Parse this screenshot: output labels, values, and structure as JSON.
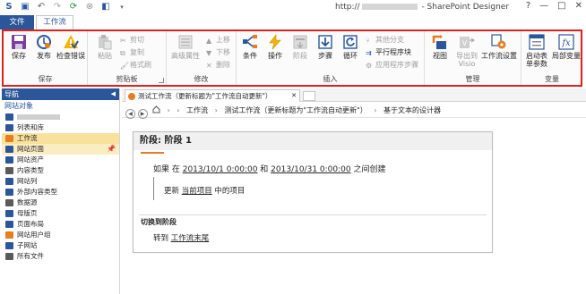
{
  "app": {
    "title_prefix": "http://",
    "title_suffix": " - SharePoint Designer",
    "quick_access": [
      "save-icon",
      "undo-icon",
      "redo-icon",
      "refresh-icon",
      "stop-icon",
      "preview-icon",
      "more-icon"
    ],
    "window_buttons": [
      "?",
      "—",
      "□",
      "✕"
    ]
  },
  "tabs": {
    "file": "文件",
    "workflow": "工作流"
  },
  "ribbon": {
    "save_group": {
      "label": "保存",
      "save": "保存",
      "publish": "发布",
      "check": "检查错误"
    },
    "clipboard_group": {
      "label": "剪贴板",
      "paste": "粘贴",
      "cut": "剪切",
      "copy": "复制",
      "format_painter": "格式刷"
    },
    "modify_group": {
      "label": "修改",
      "advanced_properties": "高级属性",
      "move_up": "上移",
      "move_down": "下移",
      "delete": "删除"
    },
    "insert_group": {
      "label": "插入",
      "condition": "条件",
      "action": "操作",
      "stage": "阶段",
      "step": "步骤",
      "loop": "循环",
      "other_branch": "其他分支",
      "parallel_block": "平行程序块",
      "app_step": "应用程序步骤"
    },
    "manage_group": {
      "label": "管理",
      "views": "视图",
      "export_visio_line1": "导出到",
      "export_visio_line2": "Visio",
      "workflow_settings": "工作流设置"
    },
    "variables_group": {
      "label": "变量",
      "initiation_line1": "启动表",
      "initiation_line2": "单参数",
      "local_vars": "局部变量"
    }
  },
  "nav": {
    "header": "导航",
    "section": "网站对象",
    "items": [
      {
        "label": "",
        "icon": "site-icon",
        "redacted": true
      },
      {
        "label": "列表和库",
        "icon": "list-icon"
      },
      {
        "label": "工作流",
        "icon": "workflow-icon",
        "state": "selected"
      },
      {
        "label": "网站页面",
        "icon": "pages-icon",
        "state": "current",
        "pinned": true
      },
      {
        "label": "网站资产",
        "icon": "assets-icon"
      },
      {
        "label": "内容类型",
        "icon": "content-type-icon"
      },
      {
        "label": "网站列",
        "icon": "column-icon"
      },
      {
        "label": "外部内容类型",
        "icon": "external-icon"
      },
      {
        "label": "数据源",
        "icon": "datasource-icon"
      },
      {
        "label": "母版页",
        "icon": "master-page-icon"
      },
      {
        "label": "页面布局",
        "icon": "layout-icon"
      },
      {
        "label": "网站用户组",
        "icon": "group-icon"
      },
      {
        "label": "子网站",
        "icon": "subsite-icon"
      },
      {
        "label": "所有文件",
        "icon": "files-icon"
      }
    ]
  },
  "document": {
    "tab_title": "测试工作流（更新标题为\"工作流自动更新\"）",
    "breadcrumb": [
      "工作流",
      "测试工作流（更新标题为\"工作流自动更新\"）",
      "基于文本的设计器"
    ],
    "stage": {
      "title": "阶段: 阶段 1",
      "cond_prefix": "如果 在 ",
      "cond_date1": "2013/10/1 0:00:00",
      "cond_mid": " 和 ",
      "cond_date2": "2013/10/31 0:00:00",
      "cond_suffix": " 之间创建",
      "action_prefix": "更新 ",
      "action_link": "当前项目",
      "action_suffix": " 中的项目",
      "transition_label": "切换到阶段",
      "transition_prefix": "转到 ",
      "transition_link": "工作流末尾"
    }
  },
  "colors": {
    "accent": "#2b579a",
    "highlight_border": "#e0201c",
    "stage_underline": "#e87d1e",
    "selected_nav": "#f9e19b"
  }
}
